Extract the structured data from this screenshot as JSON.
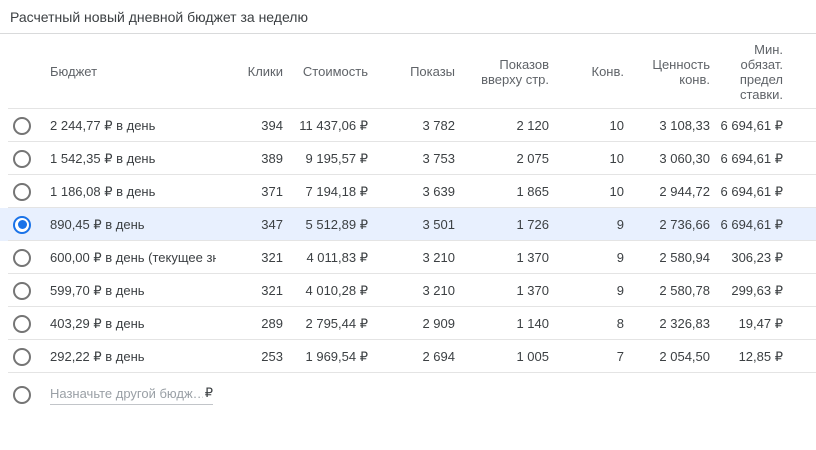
{
  "title": "Расчетный новый дневной бюджет за неделю",
  "colors": {
    "accent_blue": "#1a73e8",
    "selected_row_bg": "#e8f0fe",
    "header_text": "#5f6368",
    "body_text": "#3c4043",
    "divider": "#e4e4e4"
  },
  "table": {
    "columns": [
      {
        "label": "Бюджет"
      },
      {
        "label": "Клики"
      },
      {
        "label": "Стоимость"
      },
      {
        "label": "Показы"
      },
      {
        "label": "Показов вверху стр."
      },
      {
        "label": "Конв."
      },
      {
        "label": "Ценность конв."
      },
      {
        "label": "Мин. обязат. предел ставки."
      }
    ],
    "rows": [
      {
        "budget": "2 244,77 ₽ в день",
        "clicks": "394",
        "cost": "11 437,06 ₽",
        "impressions": "3 782",
        "top_impressions": "2 120",
        "conversions": "10",
        "conv_value": "3 108,33",
        "min_bid": "6 694,61 ₽",
        "selected": false
      },
      {
        "budget": "1 542,35 ₽ в день",
        "clicks": "389",
        "cost": "9 195,57 ₽",
        "impressions": "3 753",
        "top_impressions": "2 075",
        "conversions": "10",
        "conv_value": "3 060,30",
        "min_bid": "6 694,61 ₽",
        "selected": false
      },
      {
        "budget": "1 186,08 ₽ в день",
        "clicks": "371",
        "cost": "7 194,18 ₽",
        "impressions": "3 639",
        "top_impressions": "1 865",
        "conversions": "10",
        "conv_value": "2 944,72",
        "min_bid": "6 694,61 ₽",
        "selected": false
      },
      {
        "budget": "890,45 ₽ в день",
        "clicks": "347",
        "cost": "5 512,89 ₽",
        "impressions": "3 501",
        "top_impressions": "1 726",
        "conversions": "9",
        "conv_value": "2 736,66",
        "min_bid": "6 694,61 ₽",
        "selected": true
      },
      {
        "budget": "600,00 ₽ в день (текущее зн",
        "clicks": "321",
        "cost": "4 011,83 ₽",
        "impressions": "3 210",
        "top_impressions": "1 370",
        "conversions": "9",
        "conv_value": "2 580,94",
        "min_bid": "306,23 ₽",
        "selected": false
      },
      {
        "budget": "599,70 ₽ в день",
        "clicks": "321",
        "cost": "4 010,28 ₽",
        "impressions": "3 210",
        "top_impressions": "1 370",
        "conversions": "9",
        "conv_value": "2 580,78",
        "min_bid": "299,63 ₽",
        "selected": false
      },
      {
        "budget": "403,29 ₽ в день",
        "clicks": "289",
        "cost": "2 795,44 ₽",
        "impressions": "2 909",
        "top_impressions": "1 140",
        "conversions": "8",
        "conv_value": "2 326,83",
        "min_bid": "19,47 ₽",
        "selected": false
      },
      {
        "budget": "292,22 ₽ в день",
        "clicks": "253",
        "cost": "1 969,54 ₽",
        "impressions": "2 694",
        "top_impressions": "1 005",
        "conversions": "7",
        "conv_value": "2 054,50",
        "min_bid": "12,85 ₽",
        "selected": false
      }
    ],
    "custom_row": {
      "placeholder": "Назначьте другой бюдж…",
      "currency_suffix": "₽"
    }
  }
}
